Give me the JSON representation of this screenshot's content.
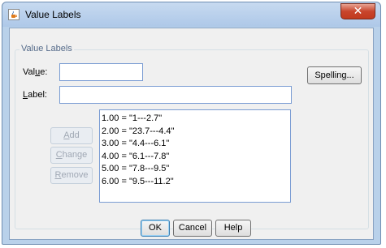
{
  "window": {
    "title": "Value Labels",
    "close_glyph": "✕"
  },
  "group": {
    "title": "Value Labels"
  },
  "value_field": {
    "label_pre": "Val",
    "label_mnemonic": "u",
    "label_post": "e:",
    "value": ""
  },
  "label_field": {
    "label_mnemonic": "L",
    "label_post": "abel:",
    "value": ""
  },
  "buttons": {
    "spelling": "Spelling...",
    "add": {
      "mnemonic": "A",
      "rest": "dd"
    },
    "change": {
      "mnemonic": "C",
      "rest": "hange"
    },
    "remove": {
      "mnemonic": "R",
      "rest": "emove"
    },
    "ok": "OK",
    "cancel": "Cancel",
    "help": "Help"
  },
  "value_labels": [
    "1.00 = \"1---2.7\"",
    "2.00 = \"23.7---4.4\"",
    "3.00 = \"4.4---6.1\"",
    "4.00 = \"6.1---7.8\"",
    "5.00 = \"7.8---9.5\"",
    "6.00 = \"9.5---11.2\""
  ]
}
